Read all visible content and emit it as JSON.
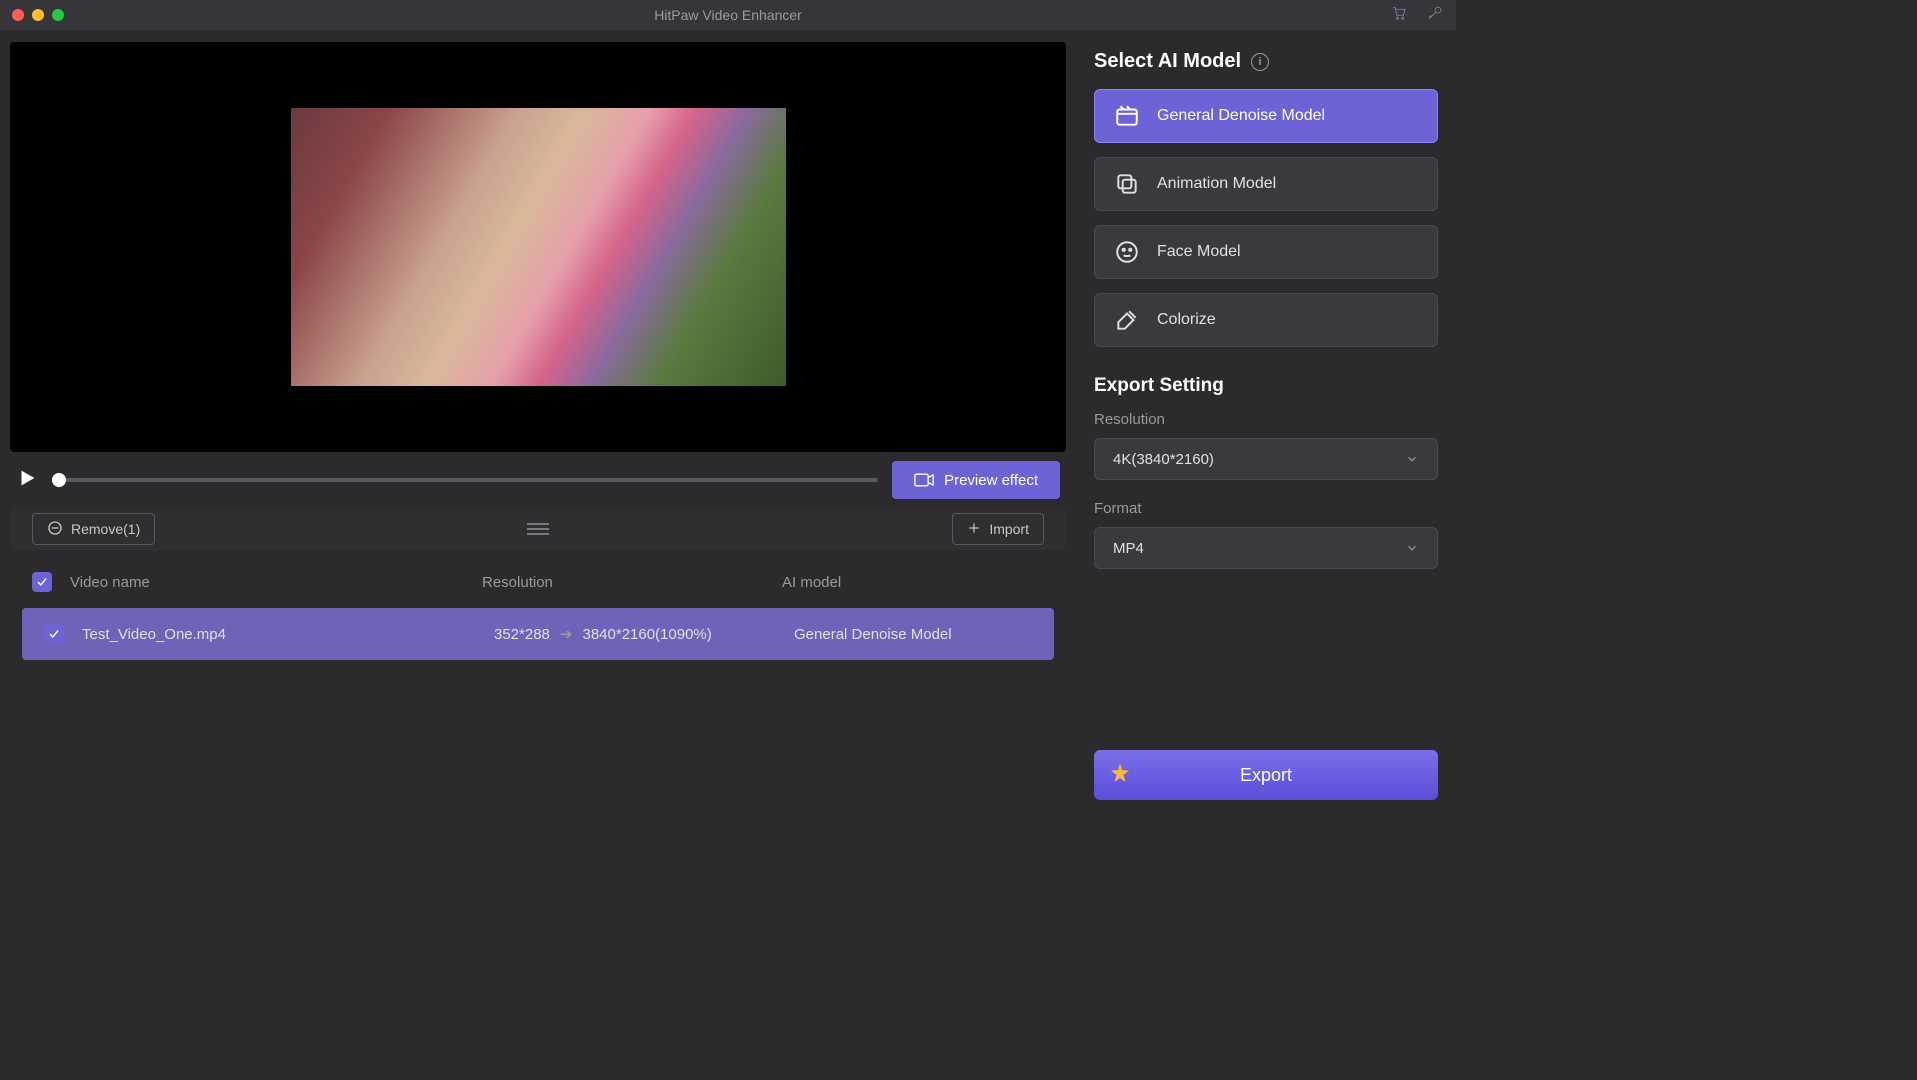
{
  "titlebar": {
    "title": "HitPaw Video Enhancer"
  },
  "controls": {
    "preview_label": "Preview effect"
  },
  "toolbar": {
    "remove_label": "Remove(1)",
    "import_label": "Import"
  },
  "table": {
    "headers": {
      "name": "Video name",
      "resolution": "Resolution",
      "model": "AI model"
    },
    "row": {
      "name": "Test_Video_One.mp4",
      "res_from": "352*288",
      "res_to": "3840*2160(1090%)",
      "model": "General Denoise Model"
    }
  },
  "sidebar": {
    "select_title": "Select AI Model",
    "models": {
      "denoise": "General Denoise Model",
      "animation": "Animation Model",
      "face": "Face Model",
      "colorize": "Colorize"
    },
    "export_title": "Export Setting",
    "resolution_label": "Resolution",
    "resolution_value": "4K(3840*2160)",
    "format_label": "Format",
    "format_value": "MP4",
    "export_btn": "Export"
  }
}
